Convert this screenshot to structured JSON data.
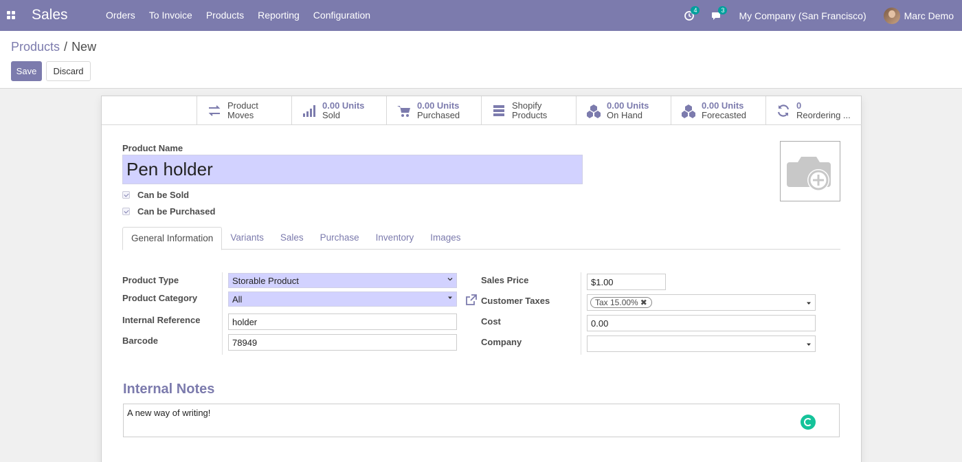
{
  "navbar": {
    "app_name": "Sales",
    "menu": [
      "Orders",
      "To Invoice",
      "Products",
      "Reporting",
      "Configuration"
    ],
    "activity_count": "4",
    "messages_count": "3",
    "company": "My Company (San Francisco)",
    "user": "Marc Demo"
  },
  "control": {
    "breadcrumb_parent": "Products",
    "breadcrumb_current": "New",
    "save_label": "Save",
    "discard_label": "Discard"
  },
  "smart_buttons": [
    {
      "value": "",
      "label1": "Product",
      "label2": "Moves",
      "icon": "exchange-icon"
    },
    {
      "value": "0.00 Units",
      "label2": "Sold",
      "icon": "signal-icon"
    },
    {
      "value": "0.00 Units",
      "label2": "Purchased",
      "icon": "cart-icon"
    },
    {
      "value": "",
      "label1": "Shopify",
      "label2": "Products",
      "icon": "stack-icon"
    },
    {
      "value": "0.00 Units",
      "label2": "On Hand",
      "icon": "cubes-icon"
    },
    {
      "value": "0.00 Units",
      "label2": "Forecasted",
      "icon": "cubes-icon"
    },
    {
      "value": "0",
      "label2": "Reordering ...",
      "icon": "refresh-icon"
    }
  ],
  "form": {
    "product_name_label": "Product Name",
    "product_name": "Pen holder",
    "can_be_sold_label": "Can be Sold",
    "can_be_purchased_label": "Can be Purchased",
    "can_be_sold": true,
    "can_be_purchased": true,
    "tabs": [
      "General Information",
      "Variants",
      "Sales",
      "Purchase",
      "Inventory",
      "Images"
    ],
    "active_tab": "General Information",
    "left": {
      "product_type_label": "Product Type",
      "product_type": "Storable Product",
      "product_category_label": "Product Category",
      "product_category": "All",
      "internal_reference_label": "Internal Reference",
      "internal_reference": "holder",
      "barcode_label": "Barcode",
      "barcode": "78949"
    },
    "right": {
      "sales_price_label": "Sales Price",
      "sales_price": "$1.00",
      "customer_taxes_label": "Customer Taxes",
      "customer_tax_tag": "Tax 15.00%",
      "cost_label": "Cost",
      "cost": "0.00",
      "company_label": "Company",
      "company": ""
    },
    "notes_title": "Internal Notes",
    "notes": "A new way of writing!"
  },
  "colors": {
    "brand": "#7c7bad",
    "required_field": "#d2d2ff",
    "badge": "#00a09d"
  }
}
